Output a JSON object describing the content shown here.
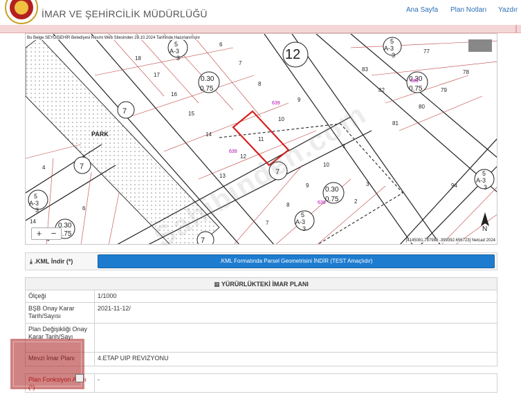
{
  "header": {
    "brand_title": "İMAR VE ŞEHİRCİLİK MÜDÜRLÜĞÜ",
    "nav": [
      "Ana Sayfa",
      "Plan Notları",
      "Yazdır"
    ]
  },
  "map": {
    "note": "Bu Belge SEYDİŞEHİR Belediyesi Resmi Web Sitesinden 28.10.2024 Tarihinde Hazırlanmıştır",
    "coords": "[4145081.787988 -399392.656723] Netcad 2024",
    "zoom_in": "+",
    "zoom_out": "−",
    "label_park": "PARK",
    "labels": [
      "12",
      "5",
      "A-3",
      "3",
      "0.30",
      "0.75",
      "7",
      "9",
      "10",
      "11",
      "12",
      "13",
      "14",
      "15",
      "16",
      "17",
      "18",
      "6",
      "8",
      "639",
      "83",
      "82",
      "81",
      "80",
      "79",
      "78",
      "77",
      "94",
      "4",
      "2",
      "3",
      "1",
      "N"
    ],
    "watermark": "Sahibinden.com",
    "colors": {
      "parcel_highlight": "#d42020",
      "road_line": "#222222",
      "park_fill": "#f4f4f4"
    }
  },
  "kml": {
    "label": ".KML İndir (*)",
    "button_text": ".KML Formatında Parsel Geometrisini İNDİR (TEST Amaçlıdır)"
  },
  "plan_table": {
    "title": "YÜRÜRLÜKTEKİ İMAR PLANI",
    "rows": [
      {
        "key": "Ölçeği",
        "value": "1/1000"
      },
      {
        "key": "BŞB Onay Karar Tarih/Sayısı",
        "value": "2021-11-12/"
      },
      {
        "key": "Plan Değişikliği Onay Karar Tarih/Sayı",
        "value": ""
      },
      {
        "key": "Mevzi İmar Planı",
        "value": "4.ETAP UIP REVIZYONU"
      },
      {
        "key": "Plan Fonksiyon Alanı (*)",
        "value": "-"
      }
    ]
  }
}
